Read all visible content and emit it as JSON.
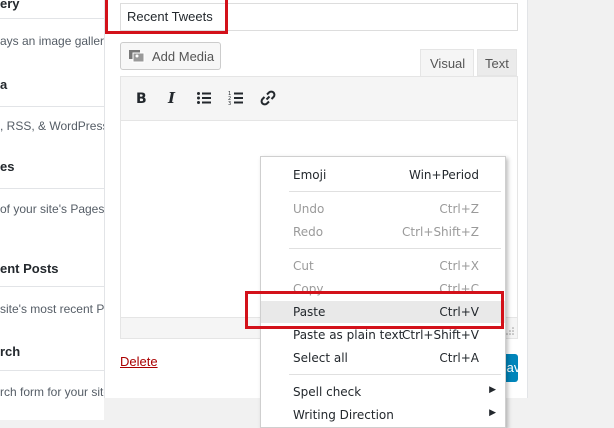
{
  "widget_list": {
    "items": [
      {
        "title": "ery",
        "description": "ays an image gallery"
      },
      {
        "title": "a",
        "description": ", RSS, & WordPress."
      },
      {
        "title": "es",
        "description": " of your site's Pages."
      },
      {
        "title": "ent Posts",
        "description": "site's most recent Po"
      },
      {
        "title": "rch",
        "description": "rch form for your site"
      }
    ]
  },
  "editor": {
    "title_value": "Recent Tweets",
    "add_media_label": "Add Media",
    "tabs": {
      "visual": "Visual",
      "text": "Text"
    },
    "toolbar": [
      {
        "icon": "bold-icon"
      },
      {
        "icon": "italic-icon"
      },
      {
        "icon": "bulleted-list-icon"
      },
      {
        "icon": "numbered-list-icon"
      },
      {
        "icon": "link-icon"
      }
    ],
    "delete_label": "Delete",
    "save_label": "Save"
  },
  "context_menu": {
    "items": [
      {
        "label": "Emoji",
        "shortcut": "Win+Period",
        "enabled": true
      },
      {
        "label": "Undo",
        "shortcut": "Ctrl+Z",
        "enabled": false
      },
      {
        "label": "Redo",
        "shortcut": "Ctrl+Shift+Z",
        "enabled": false
      },
      {
        "label": "Cut",
        "shortcut": "Ctrl+X",
        "enabled": false
      },
      {
        "label": "Copy",
        "shortcut": "Ctrl+C",
        "enabled": false
      },
      {
        "label": "Paste",
        "shortcut": "Ctrl+V",
        "enabled": true,
        "highlighted": true
      },
      {
        "label": "Paste as plain text",
        "shortcut": "Ctrl+Shift+V",
        "enabled": true
      },
      {
        "label": "Select all",
        "shortcut": "Ctrl+A",
        "enabled": true
      },
      {
        "label": "Spell check",
        "shortcut": "",
        "enabled": true,
        "submenu": true
      },
      {
        "label": "Writing Direction",
        "shortcut": "",
        "enabled": true,
        "submenu": true
      }
    ]
  },
  "colors": {
    "highlight": "#d3111a",
    "link_delete": "#aa0000",
    "primary_button": "#0085ba"
  }
}
